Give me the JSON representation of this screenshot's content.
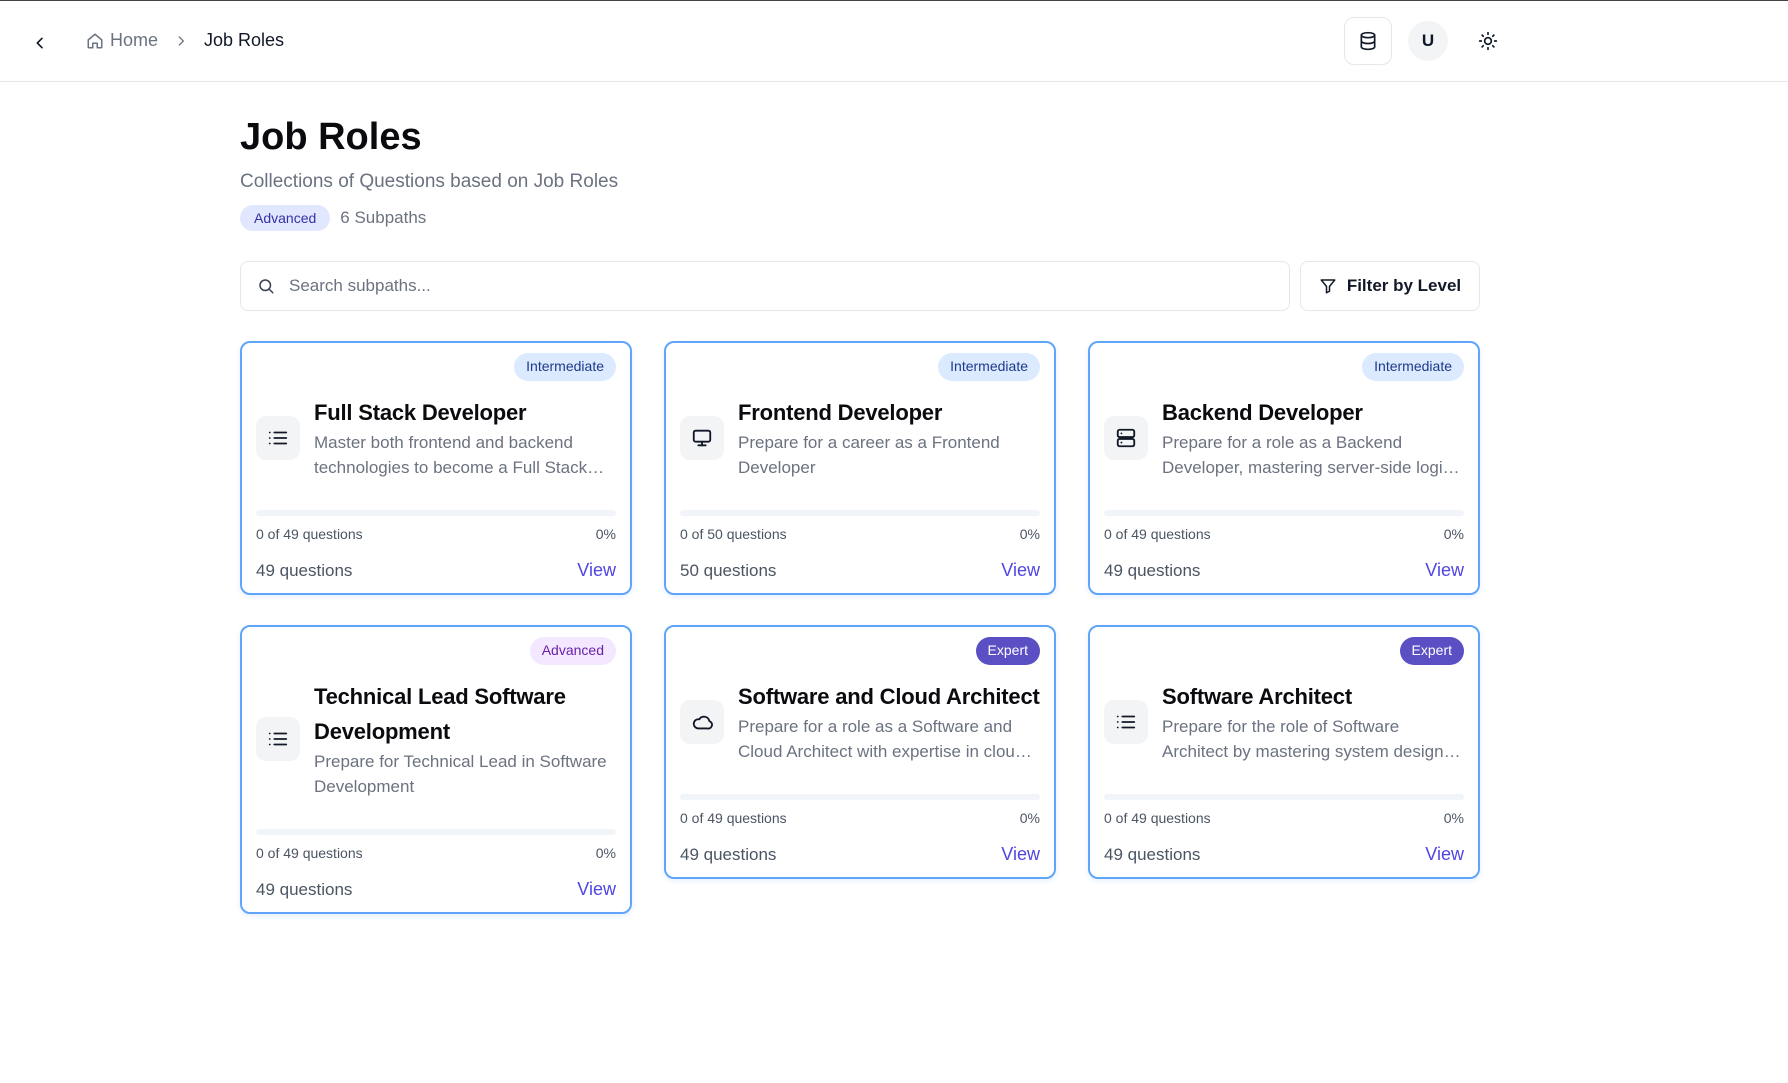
{
  "header": {
    "breadcrumb_home": "Home",
    "breadcrumb_current": "Job Roles",
    "avatar_initial": "U"
  },
  "page": {
    "title": "Job Roles",
    "subtitle": "Collections of Questions based on Job Roles",
    "level_badge": "Advanced",
    "subpath_count": "6 Subpaths"
  },
  "search": {
    "placeholder": "Search subpaths...",
    "value": ""
  },
  "filter": {
    "label": "Filter by Level"
  },
  "cards": [
    {
      "level": "Intermediate",
      "title": "Full Stack Developer",
      "description": "Master both frontend and backend technologies to become a Full Stack Developer",
      "progress_text": "0 of 49 questions",
      "progress_percent": "0%",
      "progress": 0,
      "questions": "49 questions",
      "action": "View",
      "icon": "list-icon"
    },
    {
      "level": "Intermediate",
      "title": "Frontend Developer",
      "description": "Prepare for a career as a Frontend Developer",
      "progress_text": "0 of 50 questions",
      "progress_percent": "0%",
      "progress": 0,
      "questions": "50 questions",
      "action": "View",
      "icon": "monitor-icon"
    },
    {
      "level": "Intermediate",
      "title": "Backend Developer",
      "description": "Prepare for a role as a Backend Developer, mastering server-side logic and databases",
      "progress_text": "0 of 49 questions",
      "progress_percent": "0%",
      "progress": 0,
      "questions": "49 questions",
      "action": "View",
      "icon": "server-icon"
    },
    {
      "level": "Advanced",
      "title": "Technical Lead Software Development",
      "description": "Prepare for Technical Lead in Software Development",
      "progress_text": "0 of 49 questions",
      "progress_percent": "0%",
      "progress": 0,
      "questions": "49 questions",
      "action": "View",
      "icon": "list-icon"
    },
    {
      "level": "Expert",
      "title": "Software and Cloud Architect",
      "description": "Prepare for a role as a Software and Cloud Architect with expertise in cloud platforms",
      "progress_text": "0 of 49 questions",
      "progress_percent": "0%",
      "progress": 0,
      "questions": "49 questions",
      "action": "View",
      "icon": "cloud-icon"
    },
    {
      "level": "Expert",
      "title": "Software Architect",
      "description": "Prepare for the role of Software Architect by mastering system design, patterns and scalability",
      "progress_text": "0 of 49 questions",
      "progress_percent": "0%",
      "progress": 0,
      "questions": "49 questions",
      "action": "View",
      "icon": "list-icon"
    }
  ],
  "colors": {
    "card_border": "#60a5fa",
    "intermediate_bg": "#dbeafe",
    "advanced_bg": "#f3e8ff",
    "expert_bg": "#5b4fc4",
    "link": "#4f46e5"
  }
}
